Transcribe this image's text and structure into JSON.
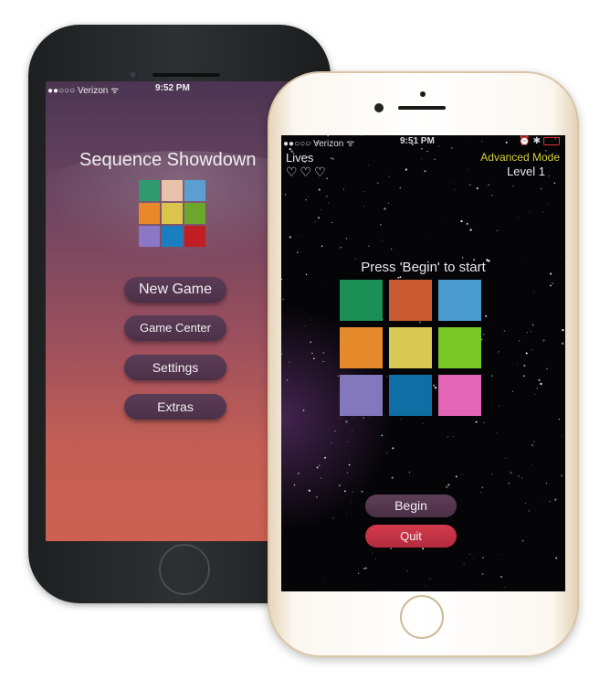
{
  "back_phone": {
    "status": {
      "carrier": "●●○○○ Verizon ᯤ",
      "time": "9:52 PM",
      "right": "⏰ ✱"
    },
    "title": "Sequence Showdown",
    "grid_colors": [
      "#2f9a6f",
      "#e9c2ac",
      "#5b9fd0",
      "#e8882b",
      "#d9c54b",
      "#6aa72a",
      "#8a78c6",
      "#1a7fc1",
      "#c11d24"
    ],
    "menu": [
      "New Game",
      "Game Center",
      "Settings",
      "Extras"
    ]
  },
  "front_phone": {
    "status": {
      "carrier": "●●○○○ Verizon ᯤ",
      "time": "9:51 PM",
      "right": "⏰ ✱"
    },
    "lives_label": "Lives",
    "hearts": "♡♡♡",
    "mode": "Advanced Mode",
    "level": "Level 1",
    "prompt": "Press 'Begin' to start",
    "grid_colors": [
      "#1b8f56",
      "#cb5a33",
      "#4a9bce",
      "#e48a2a",
      "#d8c954",
      "#7ac728",
      "#8478bd",
      "#0f6fa4",
      "#e266b5"
    ],
    "begin_label": "Begin",
    "quit_label": "Quit"
  }
}
